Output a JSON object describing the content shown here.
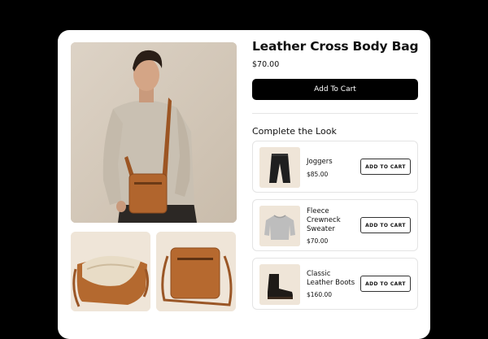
{
  "product": {
    "title": "Leather Cross Body Bag",
    "price": "$70.00",
    "add_to_cart_label": "Add To Cart",
    "images": [
      "model-wearing-bag-photo",
      "bag-open-interior-photo",
      "bag-front-photo"
    ]
  },
  "complete_the_look": {
    "heading": "Complete the Look",
    "items": [
      {
        "name": "Joggers",
        "price": "$85.00",
        "button_label": "ADD TO CART",
        "image": "joggers-photo"
      },
      {
        "name": "Fleece\nCrewneck\nSweater",
        "price": "$70.00",
        "button_label": "ADD TO CART",
        "image": "sweater-photo"
      },
      {
        "name": "Classic\nLeather Boots",
        "price": "$160.00",
        "button_label": "ADD TO CART",
        "image": "boots-photo"
      }
    ]
  },
  "colors": {
    "background": "#000000",
    "card": "#ffffff",
    "primary_button": "#000000",
    "leather": "#b5682e"
  }
}
